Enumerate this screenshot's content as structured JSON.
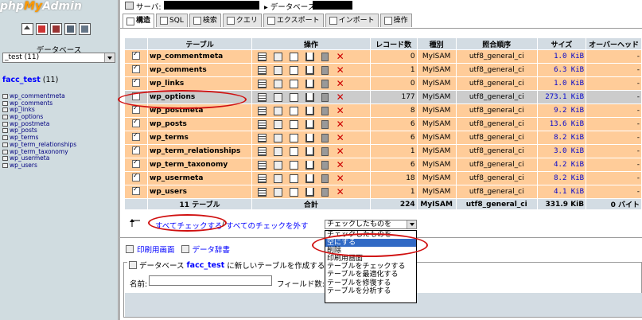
{
  "app": {
    "logo_php": "php",
    "logo_my": "MyAdmin",
    "logo_admin": "Admin"
  },
  "sidebar": {
    "db_label": "データベース",
    "db_select": "_test (11)",
    "current_db": "facc_test",
    "current_db_count": "(11)",
    "tables": [
      "wp_commentmeta",
      "wp_comments",
      "wp_links",
      "wp_options",
      "wp_postmeta",
      "wp_posts",
      "wp_terms",
      "wp_term_relationships",
      "wp_term_taxonomy",
      "wp_usermeta",
      "wp_users"
    ]
  },
  "breadcrumb": {
    "server_label": "サーバ:",
    "db_label": "データベース"
  },
  "tabs": [
    "構造",
    "SQL",
    "検索",
    "クエリ",
    "エクスポート",
    "インポート",
    "操作"
  ],
  "table_headers": {
    "table": "テーブル",
    "ops": "操作",
    "records": "レコード数",
    "type": "種別",
    "collation": "照合順序",
    "size": "サイズ",
    "overhead": "オーバーヘッド"
  },
  "rows": [
    {
      "name": "wp_commentmeta",
      "records": "0",
      "type": "MyISAM",
      "collation": "utf8_general_ci",
      "size": "1.0 KiB",
      "overhead": "-",
      "checked": true
    },
    {
      "name": "wp_comments",
      "records": "1",
      "type": "MyISAM",
      "collation": "utf8_general_ci",
      "size": "6.3 KiB",
      "overhead": "-",
      "checked": true
    },
    {
      "name": "wp_links",
      "records": "0",
      "type": "MyISAM",
      "collation": "utf8_general_ci",
      "size": "1.0 KiB",
      "overhead": "-",
      "checked": true
    },
    {
      "name": "wp_options",
      "records": "177",
      "type": "MyISAM",
      "collation": "utf8_general_ci",
      "size": "273.1 KiB",
      "overhead": "-",
      "checked": false
    },
    {
      "name": "wp_postmeta",
      "records": "8",
      "type": "MyISAM",
      "collation": "utf8_general_ci",
      "size": "9.2 KiB",
      "overhead": "-",
      "checked": true
    },
    {
      "name": "wp_posts",
      "records": "6",
      "type": "MyISAM",
      "collation": "utf8_general_ci",
      "size": "13.6 KiB",
      "overhead": "-",
      "checked": true
    },
    {
      "name": "wp_terms",
      "records": "6",
      "type": "MyISAM",
      "collation": "utf8_general_ci",
      "size": "8.2 KiB",
      "overhead": "-",
      "checked": true
    },
    {
      "name": "wp_term_relationships",
      "records": "1",
      "type": "MyISAM",
      "collation": "utf8_general_ci",
      "size": "3.0 KiB",
      "overhead": "-",
      "checked": true
    },
    {
      "name": "wp_term_taxonomy",
      "records": "6",
      "type": "MyISAM",
      "collation": "utf8_general_ci",
      "size": "4.2 KiB",
      "overhead": "-",
      "checked": true
    },
    {
      "name": "wp_usermeta",
      "records": "18",
      "type": "MyISAM",
      "collation": "utf8_general_ci",
      "size": "8.2 KiB",
      "overhead": "-",
      "checked": true
    },
    {
      "name": "wp_users",
      "records": "1",
      "type": "MyISAM",
      "collation": "utf8_general_ci",
      "size": "4.1 KiB",
      "overhead": "-",
      "checked": true
    }
  ],
  "totals": {
    "tables": "11 テーブル",
    "label": "合計",
    "records": "224",
    "type": "MyISAM",
    "collation": "utf8_general_ci",
    "size": "331.9 KiB",
    "overhead": "0 バイト"
  },
  "bulk": {
    "check_all": "すべてチェックする",
    "separator": "/",
    "uncheck_all": "すべてのチェックを外す",
    "select_value": "チェックしたものを"
  },
  "dropdown": [
    "チェックしたものを",
    "空にする",
    "削除",
    "印刷用画面",
    "テーブルをチェックする",
    "テーブルを最適化する",
    "テーブルを修復する",
    "テーブルを分析する"
  ],
  "dropdown_selected": 1,
  "links": {
    "print": "印刷用画面",
    "dict": "データ辞書"
  },
  "create": {
    "prefix": "データベース",
    "db": "facc_test",
    "suffix": "に新しいテーブルを作成する",
    "name_label": "名前:",
    "fields_label": "フィールド数:"
  },
  "colors": {
    "row_bg": "#ffcc99",
    "highlight_bg": "#cccccc",
    "header_bg": "#d3dce3",
    "annotation": "#d01010"
  }
}
